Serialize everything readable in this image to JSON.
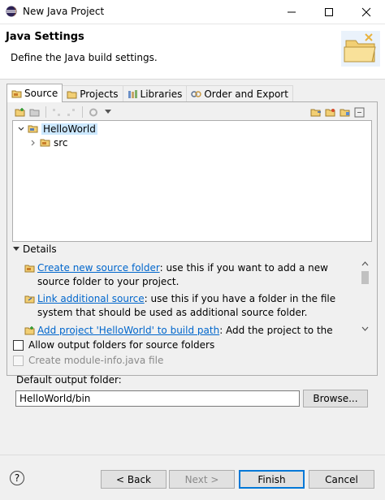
{
  "window": {
    "title": "New Java Project"
  },
  "header": {
    "title": "Java Settings",
    "description": "Define the Java build settings."
  },
  "tabs": [
    {
      "label": "Source",
      "active": true,
      "icon": "source-tab-icon"
    },
    {
      "label": "Projects",
      "active": false,
      "icon": "projects-tab-icon"
    },
    {
      "label": "Libraries",
      "active": false,
      "icon": "libraries-tab-icon"
    },
    {
      "label": "Order and Export",
      "active": false,
      "icon": "order-export-tab-icon"
    }
  ],
  "tree": {
    "items": [
      {
        "label": "HelloWorld",
        "expanded": true,
        "selected": true
      },
      {
        "label": "src",
        "expanded": false,
        "selected": false
      }
    ]
  },
  "details": {
    "label": "Details",
    "items": [
      {
        "link": "Create new source folder",
        "text": ": use this if you want to add a new source folder to your project."
      },
      {
        "link": "Link additional source",
        "text": ": use this if you have a folder in the file system that should be used as additional source folder."
      },
      {
        "link": "Add project 'HelloWorld' to build path",
        "text": ": Add the project to the build path"
      }
    ]
  },
  "options": {
    "allow_output": "Allow output folders for source folders",
    "create_module": "Create module-info.java file"
  },
  "output": {
    "label": "Default output folder:",
    "value": "HelloWorld/bin",
    "browse": "Browse..."
  },
  "buttons": {
    "help": "?",
    "back": "< Back",
    "next": "Next >",
    "finish": "Finish",
    "cancel": "Cancel"
  },
  "colors": {
    "accent": "#0078d7",
    "link": "#0066cc",
    "selection": "#cce8ff"
  }
}
